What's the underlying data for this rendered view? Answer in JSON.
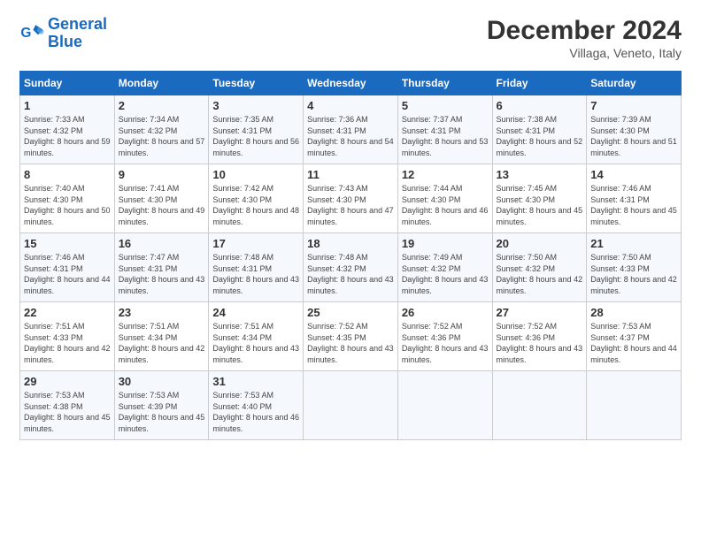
{
  "logo": {
    "line1": "General",
    "line2": "Blue"
  },
  "title": "December 2024",
  "subtitle": "Villaga, Veneto, Italy",
  "days_of_week": [
    "Sunday",
    "Monday",
    "Tuesday",
    "Wednesday",
    "Thursday",
    "Friday",
    "Saturday"
  ],
  "weeks": [
    [
      {
        "day": "1",
        "sunrise": "Sunrise: 7:33 AM",
        "sunset": "Sunset: 4:32 PM",
        "daylight": "Daylight: 8 hours and 59 minutes."
      },
      {
        "day": "2",
        "sunrise": "Sunrise: 7:34 AM",
        "sunset": "Sunset: 4:32 PM",
        "daylight": "Daylight: 8 hours and 57 minutes."
      },
      {
        "day": "3",
        "sunrise": "Sunrise: 7:35 AM",
        "sunset": "Sunset: 4:31 PM",
        "daylight": "Daylight: 8 hours and 56 minutes."
      },
      {
        "day": "4",
        "sunrise": "Sunrise: 7:36 AM",
        "sunset": "Sunset: 4:31 PM",
        "daylight": "Daylight: 8 hours and 54 minutes."
      },
      {
        "day": "5",
        "sunrise": "Sunrise: 7:37 AM",
        "sunset": "Sunset: 4:31 PM",
        "daylight": "Daylight: 8 hours and 53 minutes."
      },
      {
        "day": "6",
        "sunrise": "Sunrise: 7:38 AM",
        "sunset": "Sunset: 4:31 PM",
        "daylight": "Daylight: 8 hours and 52 minutes."
      },
      {
        "day": "7",
        "sunrise": "Sunrise: 7:39 AM",
        "sunset": "Sunset: 4:30 PM",
        "daylight": "Daylight: 8 hours and 51 minutes."
      }
    ],
    [
      {
        "day": "8",
        "sunrise": "Sunrise: 7:40 AM",
        "sunset": "Sunset: 4:30 PM",
        "daylight": "Daylight: 8 hours and 50 minutes."
      },
      {
        "day": "9",
        "sunrise": "Sunrise: 7:41 AM",
        "sunset": "Sunset: 4:30 PM",
        "daylight": "Daylight: 8 hours and 49 minutes."
      },
      {
        "day": "10",
        "sunrise": "Sunrise: 7:42 AM",
        "sunset": "Sunset: 4:30 PM",
        "daylight": "Daylight: 8 hours and 48 minutes."
      },
      {
        "day": "11",
        "sunrise": "Sunrise: 7:43 AM",
        "sunset": "Sunset: 4:30 PM",
        "daylight": "Daylight: 8 hours and 47 minutes."
      },
      {
        "day": "12",
        "sunrise": "Sunrise: 7:44 AM",
        "sunset": "Sunset: 4:30 PM",
        "daylight": "Daylight: 8 hours and 46 minutes."
      },
      {
        "day": "13",
        "sunrise": "Sunrise: 7:45 AM",
        "sunset": "Sunset: 4:30 PM",
        "daylight": "Daylight: 8 hours and 45 minutes."
      },
      {
        "day": "14",
        "sunrise": "Sunrise: 7:46 AM",
        "sunset": "Sunset: 4:31 PM",
        "daylight": "Daylight: 8 hours and 45 minutes."
      }
    ],
    [
      {
        "day": "15",
        "sunrise": "Sunrise: 7:46 AM",
        "sunset": "Sunset: 4:31 PM",
        "daylight": "Daylight: 8 hours and 44 minutes."
      },
      {
        "day": "16",
        "sunrise": "Sunrise: 7:47 AM",
        "sunset": "Sunset: 4:31 PM",
        "daylight": "Daylight: 8 hours and 43 minutes."
      },
      {
        "day": "17",
        "sunrise": "Sunrise: 7:48 AM",
        "sunset": "Sunset: 4:31 PM",
        "daylight": "Daylight: 8 hours and 43 minutes."
      },
      {
        "day": "18",
        "sunrise": "Sunrise: 7:48 AM",
        "sunset": "Sunset: 4:32 PM",
        "daylight": "Daylight: 8 hours and 43 minutes."
      },
      {
        "day": "19",
        "sunrise": "Sunrise: 7:49 AM",
        "sunset": "Sunset: 4:32 PM",
        "daylight": "Daylight: 8 hours and 43 minutes."
      },
      {
        "day": "20",
        "sunrise": "Sunrise: 7:50 AM",
        "sunset": "Sunset: 4:32 PM",
        "daylight": "Daylight: 8 hours and 42 minutes."
      },
      {
        "day": "21",
        "sunrise": "Sunrise: 7:50 AM",
        "sunset": "Sunset: 4:33 PM",
        "daylight": "Daylight: 8 hours and 42 minutes."
      }
    ],
    [
      {
        "day": "22",
        "sunrise": "Sunrise: 7:51 AM",
        "sunset": "Sunset: 4:33 PM",
        "daylight": "Daylight: 8 hours and 42 minutes."
      },
      {
        "day": "23",
        "sunrise": "Sunrise: 7:51 AM",
        "sunset": "Sunset: 4:34 PM",
        "daylight": "Daylight: 8 hours and 42 minutes."
      },
      {
        "day": "24",
        "sunrise": "Sunrise: 7:51 AM",
        "sunset": "Sunset: 4:34 PM",
        "daylight": "Daylight: 8 hours and 43 minutes."
      },
      {
        "day": "25",
        "sunrise": "Sunrise: 7:52 AM",
        "sunset": "Sunset: 4:35 PM",
        "daylight": "Daylight: 8 hours and 43 minutes."
      },
      {
        "day": "26",
        "sunrise": "Sunrise: 7:52 AM",
        "sunset": "Sunset: 4:36 PM",
        "daylight": "Daylight: 8 hours and 43 minutes."
      },
      {
        "day": "27",
        "sunrise": "Sunrise: 7:52 AM",
        "sunset": "Sunset: 4:36 PM",
        "daylight": "Daylight: 8 hours and 43 minutes."
      },
      {
        "day": "28",
        "sunrise": "Sunrise: 7:53 AM",
        "sunset": "Sunset: 4:37 PM",
        "daylight": "Daylight: 8 hours and 44 minutes."
      }
    ],
    [
      {
        "day": "29",
        "sunrise": "Sunrise: 7:53 AM",
        "sunset": "Sunset: 4:38 PM",
        "daylight": "Daylight: 8 hours and 45 minutes."
      },
      {
        "day": "30",
        "sunrise": "Sunrise: 7:53 AM",
        "sunset": "Sunset: 4:39 PM",
        "daylight": "Daylight: 8 hours and 45 minutes."
      },
      {
        "day": "31",
        "sunrise": "Sunrise: 7:53 AM",
        "sunset": "Sunset: 4:40 PM",
        "daylight": "Daylight: 8 hours and 46 minutes."
      },
      null,
      null,
      null,
      null
    ]
  ]
}
